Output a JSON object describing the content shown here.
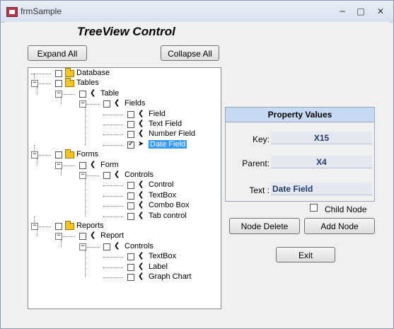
{
  "window": {
    "title": "frmSample",
    "min_glyph": "−",
    "max_glyph": "□",
    "close_glyph": "✕"
  },
  "heading": "TreeView Control",
  "buttons": {
    "expand_all": "Expand All",
    "collapse_all": "Collapse All",
    "node_delete": "Node Delete",
    "add_node": "Add Node",
    "exit": "Exit"
  },
  "tree": {
    "nodes": [
      {
        "label": "Database",
        "level": 0,
        "icon": "folder-icon"
      },
      {
        "label": "Tables",
        "level": 0,
        "icon": "folder-icon"
      },
      {
        "label": "Table",
        "level": 1,
        "icon": "arrow-icon"
      },
      {
        "label": "Fields",
        "level": 2,
        "icon": "arrow-icon"
      },
      {
        "label": "Field",
        "level": 3,
        "icon": "arrow-icon"
      },
      {
        "label": "Text Field",
        "level": 3,
        "icon": "arrow-icon"
      },
      {
        "label": "Number Field",
        "level": 3,
        "icon": "arrow-icon"
      },
      {
        "label": "Date Field",
        "level": 3,
        "icon": "arrow-icon",
        "selected": true,
        "checked": true
      },
      {
        "label": "Forms",
        "level": 0,
        "icon": "folder-icon"
      },
      {
        "label": "Form",
        "level": 1,
        "icon": "arrow-icon"
      },
      {
        "label": "Controls",
        "level": 2,
        "icon": "arrow-icon"
      },
      {
        "label": "Control",
        "level": 3,
        "icon": "arrow-icon"
      },
      {
        "label": "TextBox",
        "level": 3,
        "icon": "arrow-icon"
      },
      {
        "label": "Combo Box",
        "level": 3,
        "icon": "arrow-icon"
      },
      {
        "label": "Tab control",
        "level": 3,
        "icon": "arrow-icon"
      },
      {
        "label": "Reports",
        "level": 0,
        "icon": "folder-icon"
      },
      {
        "label": "Report",
        "level": 1,
        "icon": "arrow-icon"
      },
      {
        "label": "Controls",
        "level": 2,
        "icon": "arrow-icon"
      },
      {
        "label": "TextBox",
        "level": 3,
        "icon": "arrow-icon"
      },
      {
        "label": "Label",
        "level": 3,
        "icon": "arrow-icon"
      },
      {
        "label": "Graph Chart",
        "level": 3,
        "icon": "arrow-icon"
      }
    ]
  },
  "property_values": {
    "header": "Property Values",
    "key_label": "Key:",
    "key_value": "X15",
    "parent_label": "Parent:",
    "parent_value": "X4",
    "text_label": "Text :",
    "text_value": "Date Field"
  },
  "child_node": {
    "label": "Child Node",
    "checked": false
  }
}
